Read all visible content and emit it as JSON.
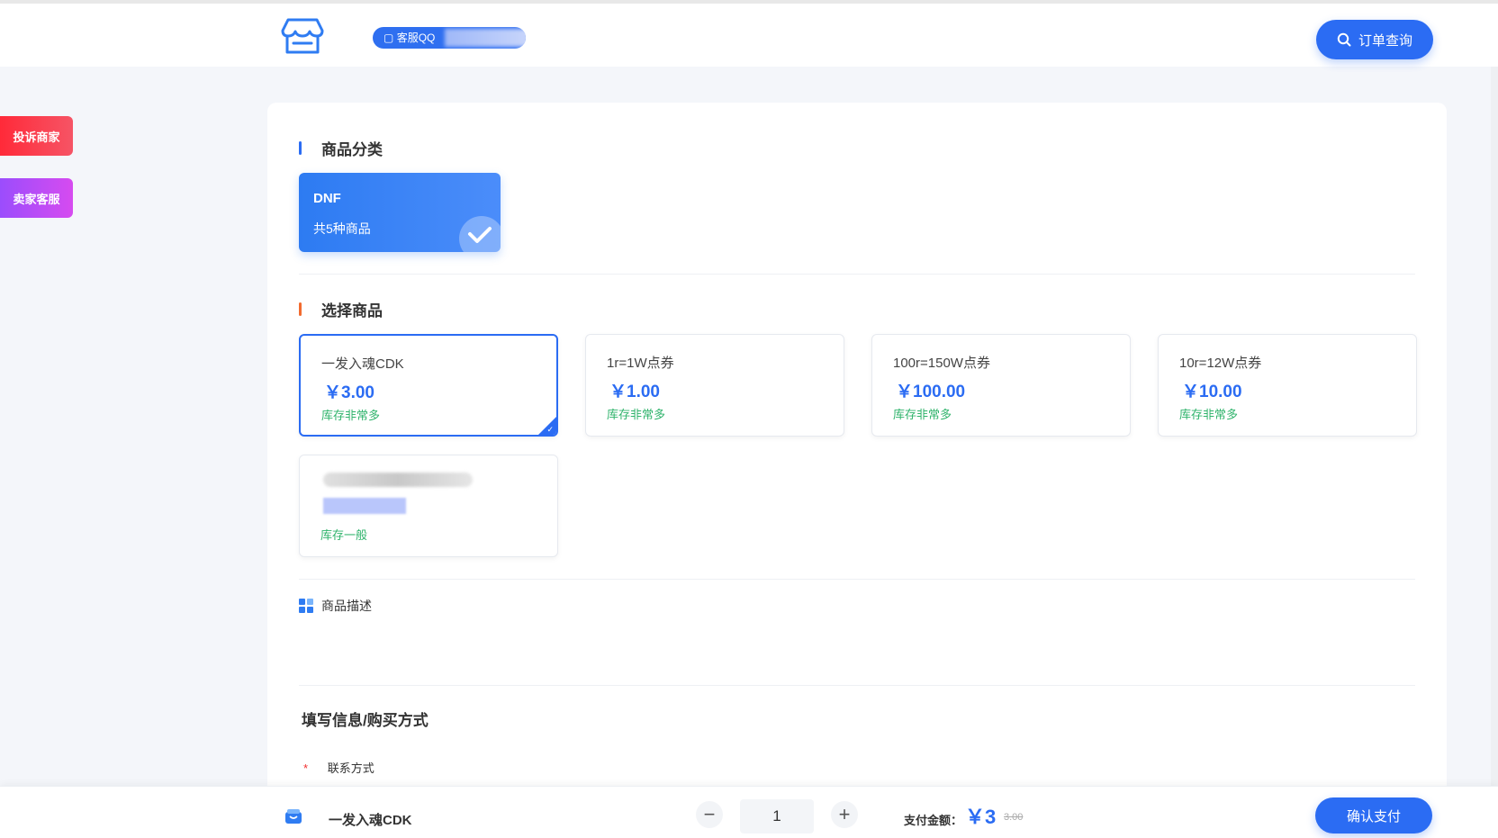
{
  "header": {
    "logo_icon": "store-icon",
    "qq_label": "客服QQ",
    "order_query_label": "订单查询",
    "search_icon": "search-icon"
  },
  "side": {
    "complain_label": "投诉商家",
    "service_label": "卖家客服"
  },
  "category": {
    "title": "商品分类",
    "items": [
      {
        "name": "DNF",
        "count": "共5种商品"
      }
    ]
  },
  "products": {
    "title": "选择商品",
    "items": [
      {
        "name": "一发入魂CDK",
        "price": "￥3.00",
        "stock": "库存非常多"
      },
      {
        "name": "1r=1W点券",
        "price": "￥1.00",
        "stock": "库存非常多"
      },
      {
        "name": "100r=150W点券",
        "price": "￥100.00",
        "stock": "库存非常多"
      },
      {
        "name": "10r=12W点券",
        "price": "￥10.00",
        "stock": "库存非常多"
      },
      {
        "stock": "库存一般"
      }
    ]
  },
  "description": {
    "title": "商品描述"
  },
  "form": {
    "title": "填写信息/购买方式",
    "required_mark": "*",
    "contact_label": "联系方式"
  },
  "bottom": {
    "product_name": "一发入魂CDK",
    "minus": "−",
    "plus": "+",
    "quantity": "1",
    "pay_label": "支付金额：",
    "pay_amount": "￥3",
    "original_price": "3.00",
    "confirm_label": "确认支付"
  },
  "colors": {
    "primary": "#2b6cf3",
    "stock_green": "#2fb36b",
    "complain_red": "#ff2a39",
    "service_purple": "#9b4dfc"
  }
}
